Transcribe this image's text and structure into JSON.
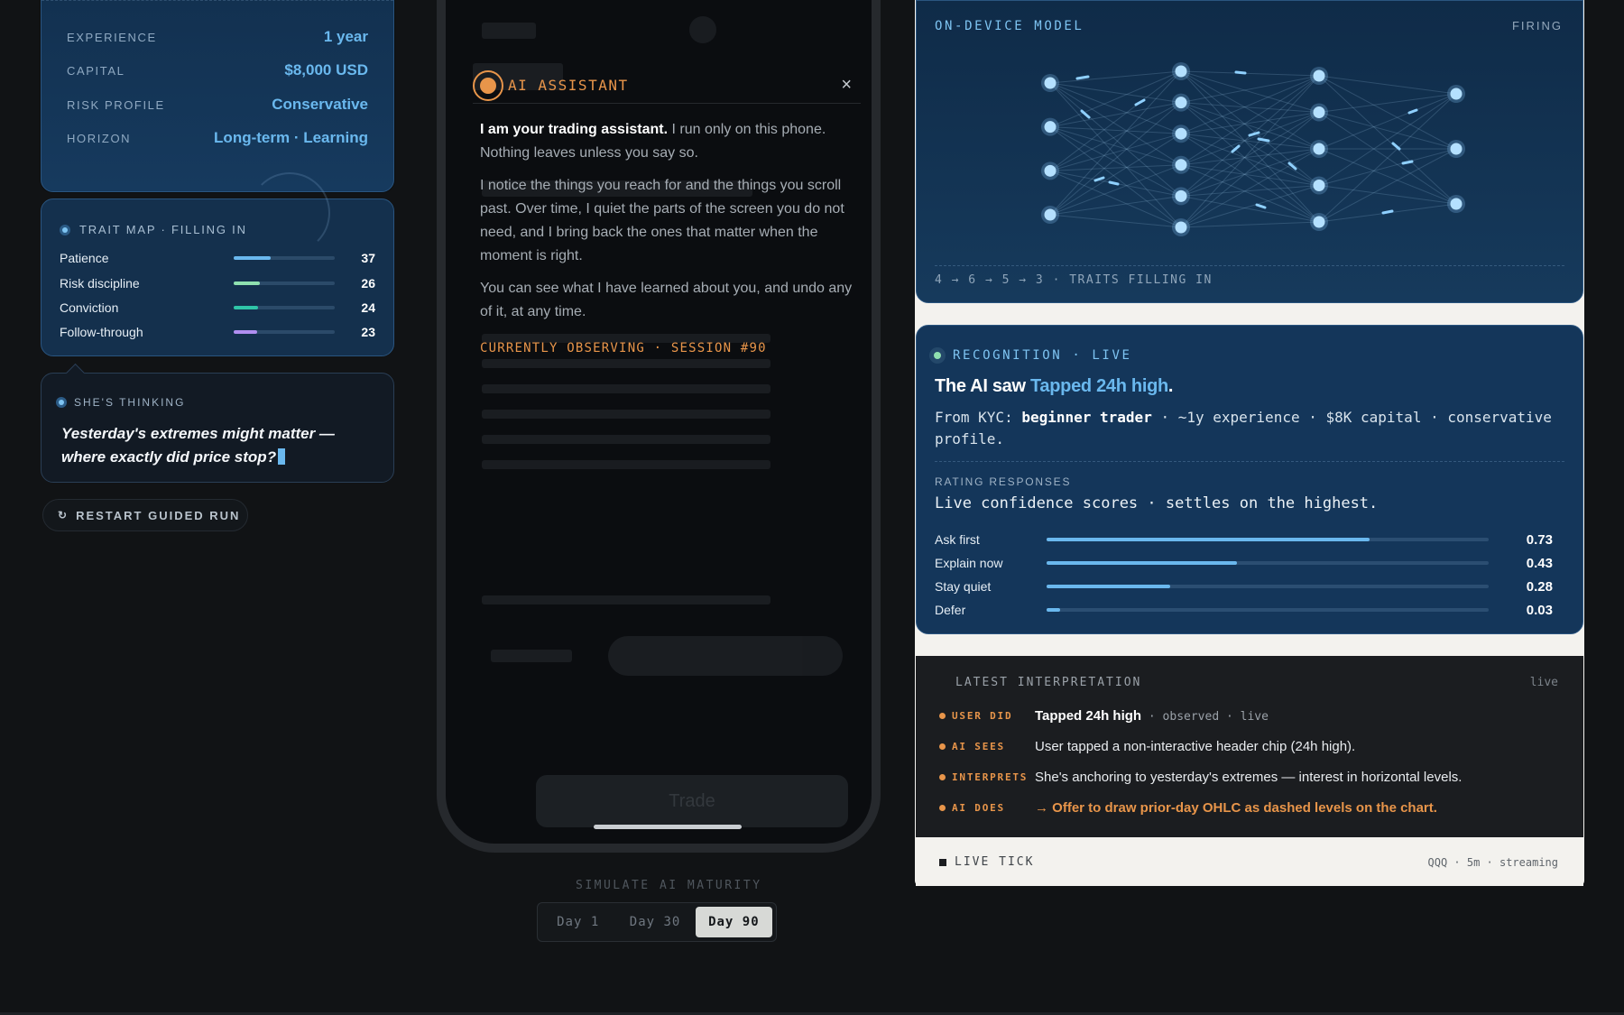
{
  "kyc": {
    "rows": [
      {
        "key": "EXPERIENCE",
        "value": "1 year"
      },
      {
        "key": "CAPITAL",
        "value": "$8,000 USD"
      },
      {
        "key": "RISK PROFILE",
        "value": "Conservative"
      },
      {
        "key": "HORIZON",
        "value": "Long-term · Learning"
      }
    ]
  },
  "trait_map": {
    "title": "TRAIT MAP · FILLING IN",
    "traits": [
      {
        "name": "Patience",
        "value": "37",
        "level": 0.37,
        "color": "#6ab8ee"
      },
      {
        "name": "Risk discipline",
        "value": "26",
        "level": 0.26,
        "color": "#8fe0b0"
      },
      {
        "name": "Conviction",
        "value": "24",
        "level": 0.24,
        "color": "#2fc5a8"
      },
      {
        "name": "Follow-through",
        "value": "23",
        "level": 0.23,
        "color": "#b08ef0"
      }
    ]
  },
  "thinking": {
    "title": "SHE'S THINKING",
    "text": "Yesterday's extremes might matter — where exactly did price stop?"
  },
  "restart": {
    "label": "RESTART GUIDED RUN",
    "icon": "restart-icon"
  },
  "assistant": {
    "title": "AI ASSISTANT",
    "close": "×",
    "intro_bold": "I am your trading assistant.",
    "intro_rest": " I run only on this phone. Nothing leaves unless you say so.",
    "para2": "I notice the things you reach for and the things you scroll past. Over time, I quiet the parts of the screen you do not need, and I bring back the ones that matter when the moment is right.",
    "para3": "You can see what I have learned about you, and undo any of it, at any time.",
    "observing": "CURRENTLY OBSERVING · SESSION #90"
  },
  "simulate": {
    "label": "SIMULATE AI MATURITY",
    "options": [
      "Day 1",
      "Day 30",
      "Day 90"
    ],
    "selected": "Day 90"
  },
  "model": {
    "label": "ON-DEVICE MODEL",
    "status": "FIRING",
    "footer": "4 → 6 → 5 → 3 · TRAITS FILLING IN",
    "layers": [
      4,
      6,
      5,
      3
    ]
  },
  "recognition": {
    "label": "RECOGNITION · LIVE",
    "title_prefix": "The AI saw ",
    "title_highlight": "Tapped 24h high",
    "title_suffix": ".",
    "desc_prefix": "From KYC: ",
    "desc_bold": "beginner trader",
    "desc_rest": " · ~1y experience · $8K capital · conservative profile.",
    "rating_label": "RATING RESPONSES",
    "rating_sub": "Live confidence scores · settles on the highest.",
    "responses": [
      {
        "name": "Ask first",
        "value": "0.73",
        "score": 0.73
      },
      {
        "name": "Explain now",
        "value": "0.43",
        "score": 0.43
      },
      {
        "name": "Stay quiet",
        "value": "0.28",
        "score": 0.28
      },
      {
        "name": "Defer",
        "value": "0.03",
        "score": 0.03
      }
    ]
  },
  "interpretation": {
    "label": "LATEST INTERPRETATION",
    "live": "live",
    "rows": [
      {
        "tag": "USER DID",
        "text": "Tapped 24h high",
        "meta": " · observed · live"
      },
      {
        "tag": "AI SEES",
        "text": "User tapped a non-interactive header chip (24h high).",
        "meta": ""
      },
      {
        "tag": "INTERPRETS",
        "text": "She's anchoring to yesterday's extremes — interest in horizontal levels.",
        "meta": ""
      },
      {
        "tag": "AI DOES",
        "text": "→ Offer to draw prior-day OHLC as dashed levels on the chart.",
        "meta": ""
      }
    ]
  },
  "tick": {
    "label": "LIVE TICK",
    "meta": "QQQ · 5m · streaming"
  },
  "colors": {
    "accent_blue": "#6ab8ee",
    "accent_orange": "#e8954a",
    "accent_green": "#8fe0b0"
  }
}
